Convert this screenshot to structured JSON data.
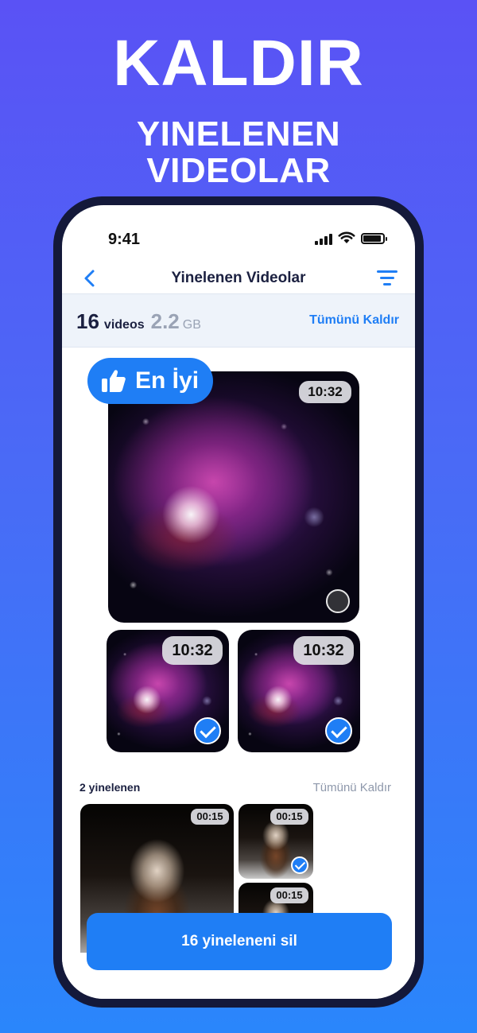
{
  "promo": {
    "headline": "KALDIR",
    "subheadline_line1": "YINELENEN",
    "subheadline_line2": "VIDEOLAR"
  },
  "status_bar": {
    "time": "9:41"
  },
  "nav": {
    "title": "Yinelenen Videolar",
    "back_icon": "chevron-left-icon",
    "filter_icon": "filter-icon"
  },
  "summary": {
    "count": "16",
    "count_unit": "videos",
    "size": "2.2",
    "size_unit": "GB",
    "action_label": "Tümünü Kaldır"
  },
  "best_group": {
    "badge_label": "En İyi",
    "badge_icon": "thumbs-up-icon",
    "main": {
      "duration": "10:32",
      "selected": false
    },
    "duplicates": [
      {
        "duration": "10:32",
        "selected": true
      },
      {
        "duration": "10:32",
        "selected": true
      }
    ]
  },
  "second_group": {
    "label": "2 yinelenen",
    "action_label": "Tümünü Kaldır",
    "items": [
      {
        "duration": "00:15"
      },
      {
        "duration": "00:15",
        "selected": true
      },
      {
        "duration": "00:15"
      }
    ]
  },
  "primary_action": {
    "label": "16 yineleneni sil"
  },
  "colors": {
    "accent": "#1f7ef5",
    "background_top": "#5a52f5",
    "background_bottom": "#2a86fb",
    "title_text": "#1b2040",
    "muted_text": "#9aa3b5"
  }
}
